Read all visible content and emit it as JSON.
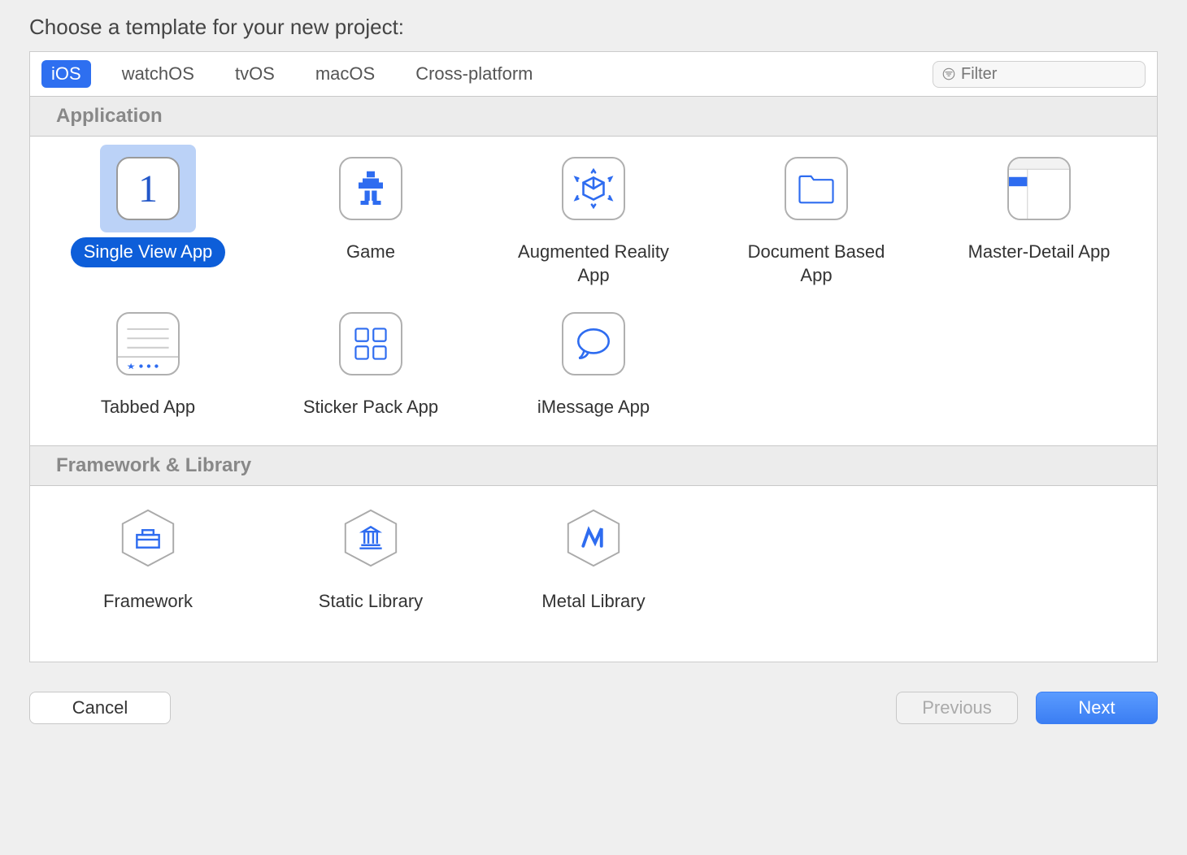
{
  "dialog": {
    "title": "Choose a template for your new project:"
  },
  "tabs": {
    "ios": "iOS",
    "watchos": "watchOS",
    "tvos": "tvOS",
    "macos": "macOS",
    "crossplatform": "Cross-platform",
    "active": "ios"
  },
  "filter": {
    "placeholder": "Filter"
  },
  "sections": {
    "application": "Application",
    "framework": "Framework & Library"
  },
  "templates": {
    "application": [
      {
        "id": "single-view-app",
        "label": "Single View App",
        "selected": true
      },
      {
        "id": "game",
        "label": "Game"
      },
      {
        "id": "ar-app",
        "label": "Augmented Reality App"
      },
      {
        "id": "doc-based-app",
        "label": "Document Based App"
      },
      {
        "id": "master-detail-app",
        "label": "Master-Detail App"
      },
      {
        "id": "tabbed-app",
        "label": "Tabbed App"
      },
      {
        "id": "sticker-pack-app",
        "label": "Sticker Pack App"
      },
      {
        "id": "imessage-app",
        "label": "iMessage App"
      }
    ],
    "framework": [
      {
        "id": "framework",
        "label": "Framework"
      },
      {
        "id": "static-library",
        "label": "Static Library"
      },
      {
        "id": "metal-library",
        "label": "Metal Library"
      }
    ]
  },
  "buttons": {
    "cancel": "Cancel",
    "previous": "Previous",
    "next": "Next"
  }
}
